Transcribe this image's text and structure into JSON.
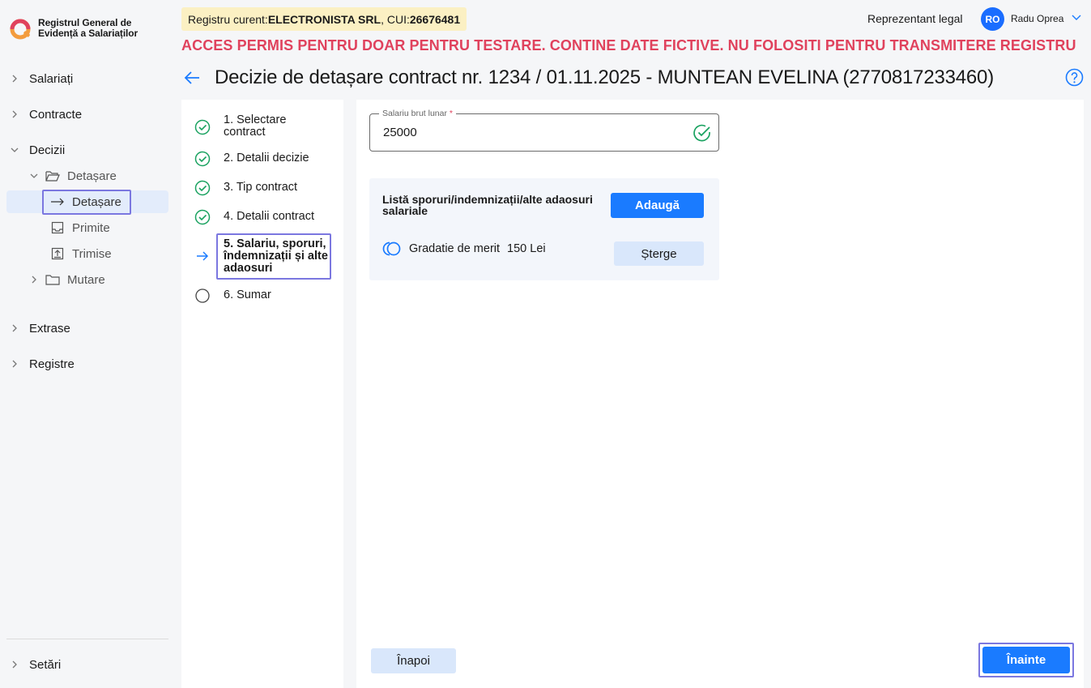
{
  "app": {
    "title_line1": "Registrul General de",
    "title_line2": "Evidență a Salariaților"
  },
  "sidebar": {
    "items": [
      {
        "label": "Salariați"
      },
      {
        "label": "Contracte"
      },
      {
        "label": "Decizii"
      },
      {
        "label": "Extrase"
      },
      {
        "label": "Registre"
      }
    ],
    "decizii_children": [
      {
        "label": "Detașare"
      },
      {
        "label": "Detașare"
      },
      {
        "label": "Primite"
      },
      {
        "label": "Trimise"
      },
      {
        "label": "Mutare"
      }
    ],
    "settings_label": "Setări"
  },
  "header": {
    "registry_prefix": "Registru curent: ",
    "registry_company": "ELECTRONISTA SRL",
    "registry_cui_prefix": ", CUI: ",
    "registry_cui": "26676481",
    "role": "Reprezentant legal",
    "avatar_initials": "RO",
    "user_name": "Radu Oprea",
    "warning": "ACCES PERMIS PENTRU DOAR PENTRU TESTARE. CONTINE DATE FICTIVE. NU FOLOSITI PENTRU TRANSMITERE REGISTRU"
  },
  "page": {
    "title": "Decizie de detașare contract nr. 1234 / 01.11.2025 - MUNTEAN EVELINA (2770817233460)"
  },
  "steps": [
    {
      "line1": "1. Selectare",
      "line2": "contract",
      "status": "done"
    },
    {
      "line1": "2. Detalii decizie",
      "status": "done"
    },
    {
      "line1": "3. Tip contract",
      "status": "done"
    },
    {
      "line1": "4. Detalii contract",
      "status": "done"
    },
    {
      "line1": "5. Salariu, sporuri,",
      "line2": "îndemnizații și alte",
      "line3": "adaosuri",
      "status": "current"
    },
    {
      "line1": "6. Sumar",
      "status": "pending"
    }
  ],
  "form": {
    "salary_label": "Salariu brut lunar",
    "salary_required_mark": "*",
    "salary_value": "25000",
    "bonus_title": "Listă sporuri/indemnizații/alte adaosuri salariale",
    "add_button": "Adaugă",
    "bonuses": [
      {
        "name": "Gradatie de merit",
        "amount": "150 Lei",
        "delete_label": "Șterge"
      }
    ]
  },
  "footer": {
    "back_button": "Înapoi",
    "next_button": "Înainte"
  },
  "colors": {
    "accent": "#1a7bff",
    "success": "#1aa260",
    "warning_text": "#e0425d",
    "highlight_outline": "#7b77e0",
    "registry_badge_bg": "#fbf0c3"
  }
}
